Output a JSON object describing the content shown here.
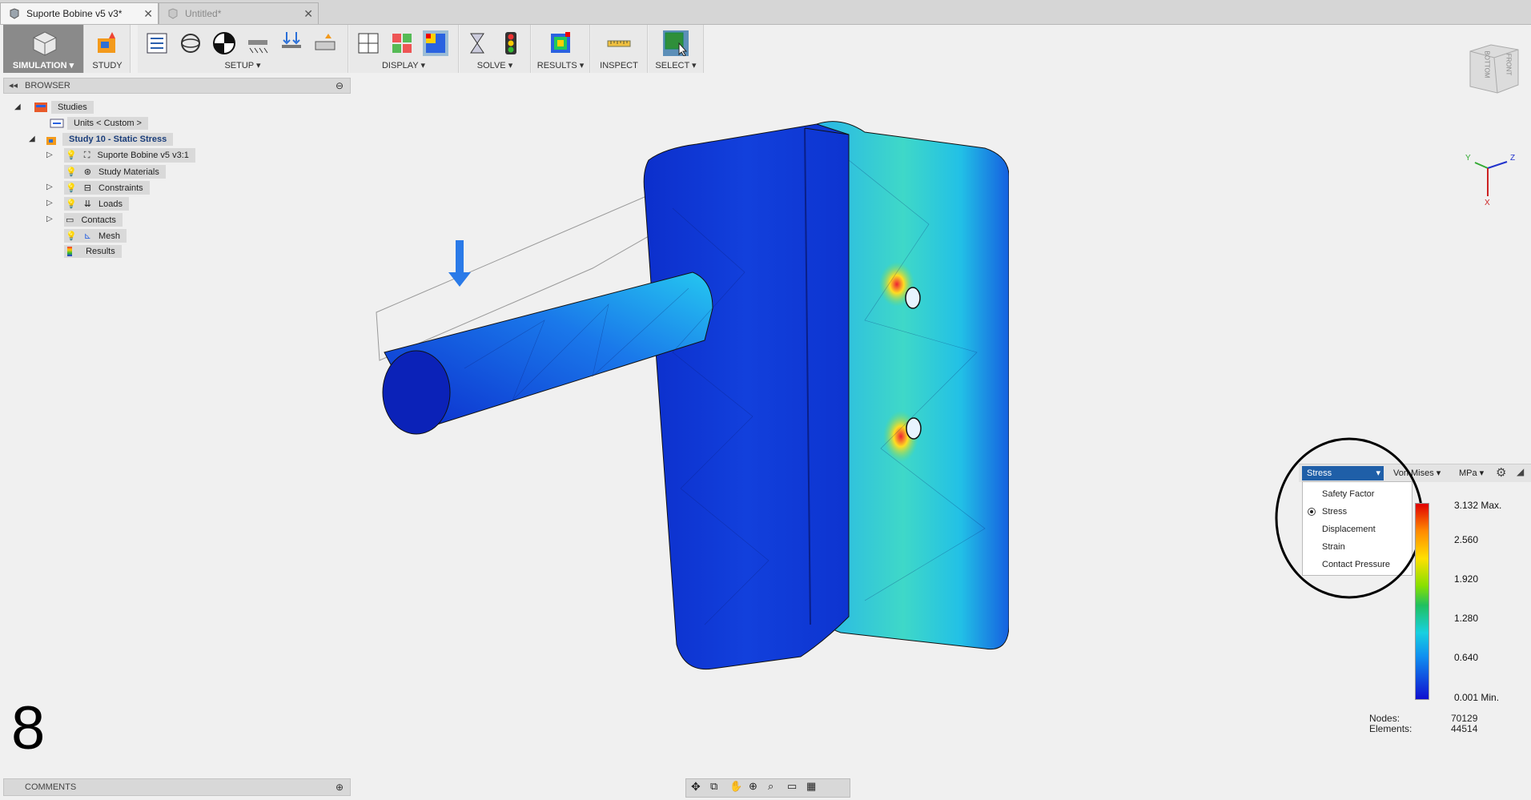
{
  "tabs": [
    {
      "label": "Suporte Bobine v5 v3*",
      "active": true
    },
    {
      "label": "Untitled*",
      "active": false
    }
  ],
  "toolbar": {
    "workspace_label": "SIMULATION",
    "groups": [
      "STUDY",
      "SETUP",
      "DISPLAY",
      "SOLVE",
      "RESULTS",
      "INSPECT",
      "SELECT"
    ]
  },
  "browser": {
    "title": "BROWSER",
    "items": [
      {
        "label": "Studies"
      },
      {
        "label": "Units < Custom >"
      },
      {
        "label": "Study 10 - Static Stress"
      },
      {
        "label": "Suporte Bobine v5 v3:1"
      },
      {
        "label": "Study Materials"
      },
      {
        "label": "Constraints"
      },
      {
        "label": "Loads"
      },
      {
        "label": "Contacts"
      },
      {
        "label": "Mesh"
      },
      {
        "label": "Results"
      }
    ]
  },
  "comments": {
    "title": "COMMENTS"
  },
  "viewcube": {
    "faces": [
      "BOTTOM",
      "FRONT"
    ]
  },
  "triad": {
    "axes": [
      "Y",
      "Z",
      "X"
    ]
  },
  "step_number": "8",
  "legend": {
    "result_type": "Stress",
    "component": "Von Mises",
    "unit": "MPa",
    "menu_items": [
      "Safety Factor",
      "Stress",
      "Displacement",
      "Strain",
      "Contact Pressure"
    ],
    "selected_index": 1,
    "values": [
      "3.132 Max.",
      "2.560",
      "1.920",
      "1.280",
      "0.640",
      "0.001 Min."
    ],
    "nodes_label": "Nodes:",
    "nodes_value": "70129",
    "elements_label": "Elements:",
    "elements_value": "44514"
  },
  "colors": {
    "accent": "#1a5ea8",
    "legend_top": "#e00000",
    "legend_bottom": "#1010d0"
  }
}
